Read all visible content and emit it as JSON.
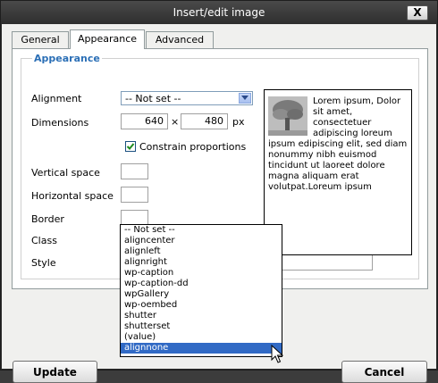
{
  "window": {
    "title": "Insert/edit image",
    "close_label": "X"
  },
  "tabs": [
    {
      "label": "General",
      "active": false
    },
    {
      "label": "Appearance",
      "active": true
    },
    {
      "label": "Advanced",
      "active": false
    }
  ],
  "appearance": {
    "legend": "Appearance",
    "alignment_label": "Alignment",
    "alignment_value": "-- Not set --",
    "dimensions_label": "Dimensions",
    "width": "640",
    "times": "×",
    "height": "480",
    "unit": "px",
    "constrain_label": "Constrain proportions",
    "constrain_checked": true,
    "vspace_label": "Vertical space",
    "vspace_value": "",
    "hspace_label": "Horizontal space",
    "hspace_value": "",
    "border_label": "Border",
    "border_value": "",
    "class_label": "Class",
    "class_value": "alignnone",
    "style_label": "Style",
    "style_value": ""
  },
  "preview": {
    "text": "Lorem ipsum, Dolor sit amet, consectetuer adipiscing loreum ipsum edipiscing elit, sed diam nonummy nibh euismod tincidunt ut laoreet dolore magna aliquam erat volutpat.Loreum ipsum"
  },
  "class_options": [
    "-- Not set --",
    "aligncenter",
    "alignleft",
    "alignright",
    "wp-caption",
    "wp-caption-dd",
    "wpGallery",
    "wp-oembed",
    "shutter",
    "shutterset",
    "(value)",
    "alignnone"
  ],
  "class_selected_index": 11,
  "buttons": {
    "update": "Update",
    "cancel": "Cancel"
  },
  "colors": {
    "accent": "#2b6fb6",
    "selection": "#316ac5",
    "checkmark": "#1e8a1e"
  }
}
